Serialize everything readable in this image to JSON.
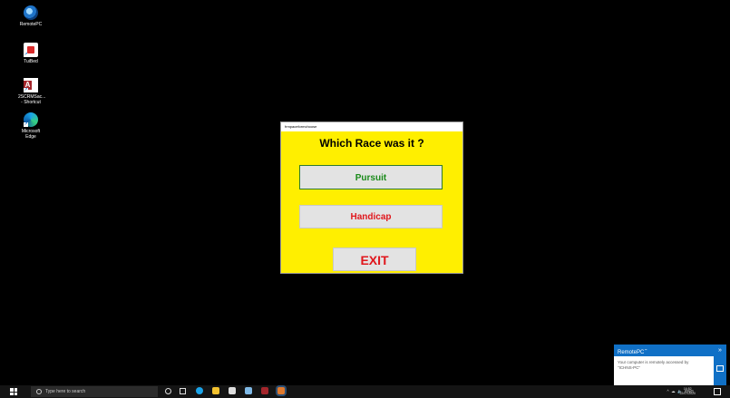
{
  "desktop": {
    "icons": [
      {
        "label": "RemotePC",
        "icon": "remotepc-icon"
      },
      {
        "label": "TuiBed",
        "icon": "pdf-icon"
      },
      {
        "label": "2SCRMSac... - Shortcut",
        "icon": "access-icon"
      },
      {
        "label": "Microsoft Edge",
        "icon": "edge-icon"
      }
    ]
  },
  "dialog": {
    "title": "frmpaceformchoose",
    "question": "Which Race was it ?",
    "buttons": {
      "pursuit": "Pursuit",
      "handicap": "Handicap",
      "exit": "EXIT"
    },
    "colors": {
      "background": "#ffef00",
      "pursuit_text": "#1a8a1a",
      "handicap_text": "#e0161c",
      "exit_text": "#e0161c"
    }
  },
  "taskbar": {
    "search_placeholder": "Type here to search",
    "tray_text": "ENG",
    "time": "16:52",
    "date": "22/07/2020"
  },
  "toast": {
    "title": "RemotePC",
    "message": "Your computer is remotely accessed by \"ICHNS-PC\""
  }
}
